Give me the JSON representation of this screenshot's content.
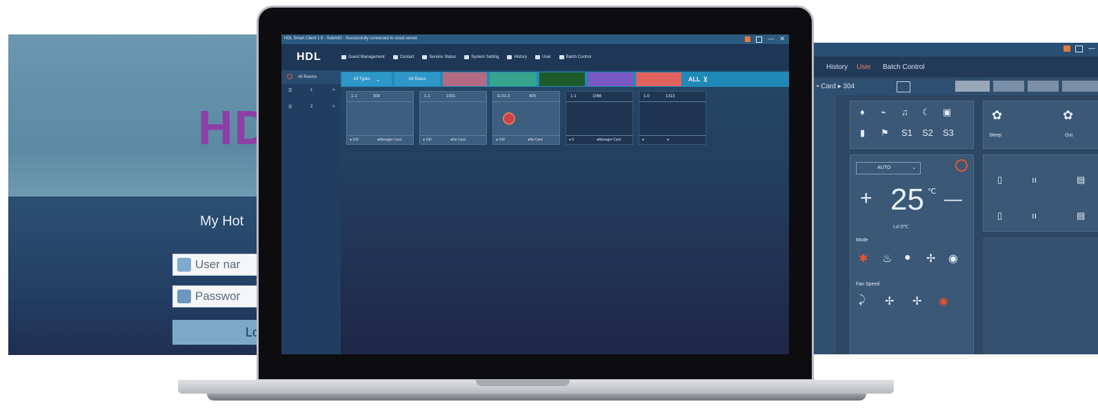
{
  "login": {
    "logo": "HD",
    "hotel_title": "My Hot",
    "username_placeholder": "User nar",
    "password_placeholder": "Passwor",
    "login_label": "Lo"
  },
  "app": {
    "title": "HDL Smart Client 1.9 - Submit2 - Successfully connected to cloud server.",
    "logo": "HDL",
    "menu": [
      "Guest Management",
      "Contact",
      "Service Status",
      "System Setting",
      "History",
      "User",
      "Batch Control"
    ],
    "sidebar": {
      "all_rooms": "All Rooms",
      "floors": [
        {
          "icon": "☰",
          "count": "1",
          "arrow": ">"
        },
        {
          "icon": "☰",
          "count": "2",
          "arrow": ">"
        }
      ]
    },
    "filters": [
      "All Types",
      "All Status",
      "",
      "",
      "",
      "",
      "",
      "ALL"
    ],
    "rooms": [
      {
        "hd_left": "1-1",
        "hd_right": "304",
        "ft_left": "● 100",
        "ft_right": "●Manager Card"
      },
      {
        "hd_left": "1-1",
        "hd_right": "1001",
        "ft_left": "● 100",
        "ft_right": "●No Card"
      },
      {
        "hd_left": "D-01-3",
        "hd_right": "400",
        "ft_left": "● 100",
        "ft_right": "●No Card"
      },
      {
        "hd_left": "1-1",
        "hd_right": "1066",
        "ft_left": "● 0",
        "ft_right": "●Manager Card"
      },
      {
        "hd_left": "1-0",
        "hd_right": "1313",
        "ft_left": "●",
        "ft_right": "●"
      }
    ]
  },
  "right_panel": {
    "menu": [
      "History",
      "User",
      "Batch Control"
    ],
    "subbar": "• Card   ▸ 304",
    "ac": {
      "mode_select": "AUTO",
      "temp": "25",
      "unit": "℃",
      "plus": "+",
      "minus": "—",
      "room_temp": "Lvl  0℃",
      "mode_label": "Mode",
      "fan_label": "Fan Speed"
    },
    "scene_labels": [
      "S1",
      "S2",
      "S3"
    ],
    "card2_labels": [
      "Sleep",
      "Out"
    ]
  },
  "colors": {
    "accent": "#2089b8",
    "chip_pink": "#b26b82",
    "chip_teal": "#37a58e",
    "chip_green": "#1f5a2a",
    "chip_purple": "#7b59c4",
    "chip_red": "#e0615e",
    "logo_purple": "#8e3fa6"
  }
}
